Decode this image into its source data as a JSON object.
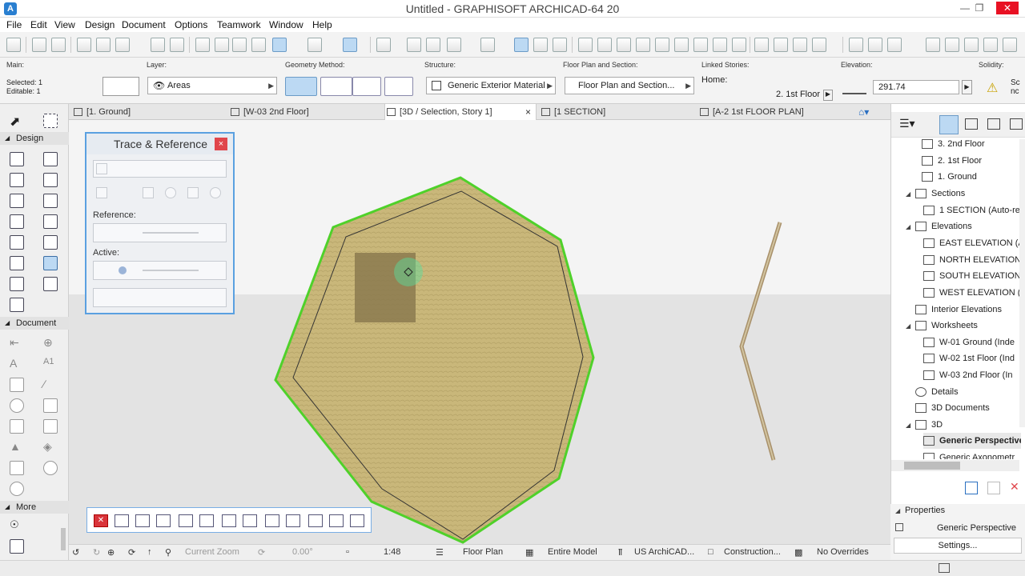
{
  "window": {
    "title": "Untitled - GRAPHISOFT ARCHICAD-64 20",
    "app_icon": "A"
  },
  "menu": [
    "File",
    "Edit",
    "View",
    "Design",
    "Document",
    "Options",
    "Teamwork",
    "Window",
    "Help"
  ],
  "infobox": {
    "main_label": "Main:",
    "selected": "Selected: 1",
    "editable": "Editable: 1",
    "layer_label": "Layer:",
    "layer_value": "Areas",
    "geometry_label": "Geometry Method:",
    "structure_label": "Structure:",
    "structure_value": "Generic Exterior Material",
    "floorplan_label": "Floor Plan and Section:",
    "floorplan_value": "Floor Plan and Section...",
    "linked_label": "Linked Stories:",
    "home_label": "Home:",
    "home_value": "2. 1st Floor",
    "elevation_label": "Elevation:",
    "elevation_value": "291.74",
    "solidity_label": "Solidity:",
    "solidity_value": "Sc nc"
  },
  "tabs": [
    {
      "label": "[1. Ground]"
    },
    {
      "label": "[W-03 2nd Floor]"
    },
    {
      "label": "[3D / Selection, Story 1]",
      "active": true
    },
    {
      "label": "[1 SECTION]"
    },
    {
      "label": "[A-2 1st FLOOR PLAN]"
    }
  ],
  "toolbox": {
    "design": "Design",
    "document": "Document",
    "more": "More"
  },
  "trace": {
    "title": "Trace & Reference",
    "reference_label": "Reference:",
    "active_label": "Active:",
    "close": "×"
  },
  "navigator": {
    "items": [
      {
        "label": "3. 2nd Floor"
      },
      {
        "label": "2. 1st Floor"
      },
      {
        "label": "1. Ground"
      },
      {
        "label": "Sections"
      },
      {
        "label": "1 SECTION (Auto-re"
      },
      {
        "label": "Elevations"
      },
      {
        "label": "EAST ELEVATION (Au"
      },
      {
        "label": "NORTH ELEVATION"
      },
      {
        "label": "SOUTH ELEVATION"
      },
      {
        "label": "WEST ELEVATION (A"
      },
      {
        "label": "Interior Elevations"
      },
      {
        "label": "Worksheets"
      },
      {
        "label": "W-01 Ground (Inde"
      },
      {
        "label": "W-02 1st Floor (Ind"
      },
      {
        "label": "W-03 2nd Floor (In"
      },
      {
        "label": "Details"
      },
      {
        "label": "3D Documents"
      },
      {
        "label": "3D"
      },
      {
        "label": "Generic Perspective"
      },
      {
        "label": "Generic Axonometr"
      }
    ],
    "properties_label": "Properties",
    "properties_value": "Generic Perspective",
    "settings_label": "Settings..."
  },
  "status": {
    "zoom": "Current Zoom",
    "angle": "0.00°",
    "scale": "1:48",
    "view": "Floor Plan",
    "model": "Entire Model",
    "standard": "US ArchiCAD...",
    "construction": "Construction...",
    "overrides": "No Overrides"
  },
  "colors": {
    "accent": "#5aa0e0",
    "selection": "#4fd12a",
    "slab": "#c8b878"
  }
}
